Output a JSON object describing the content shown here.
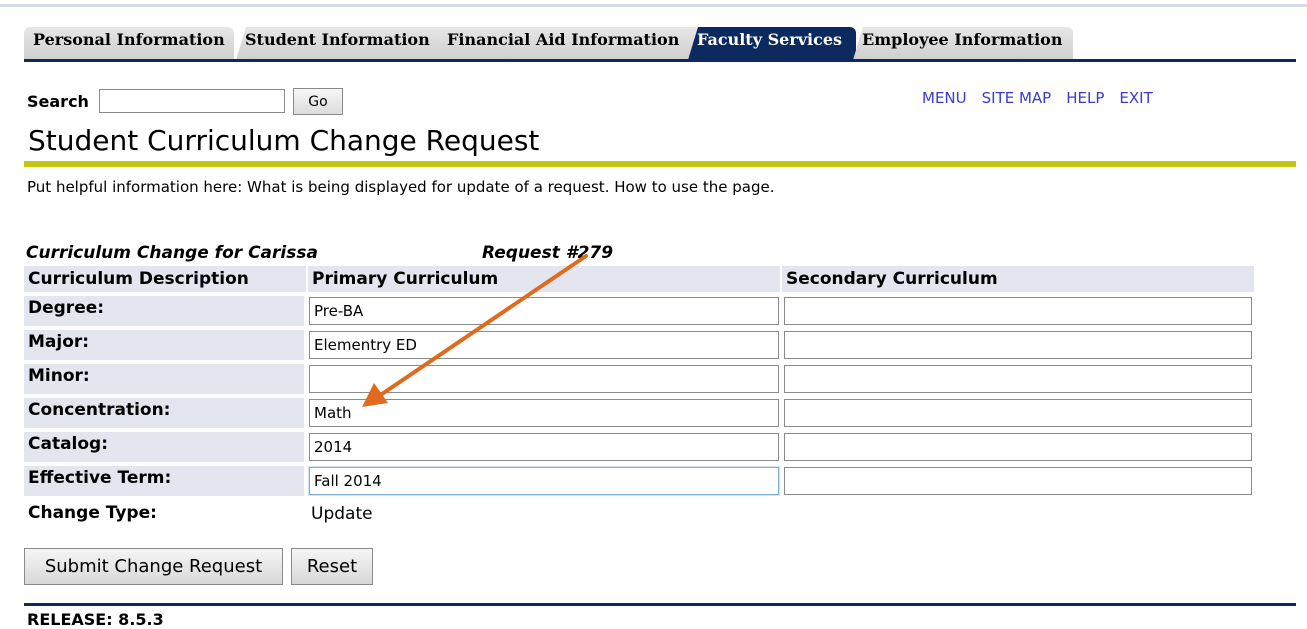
{
  "tabs": [
    {
      "label": "Personal Information"
    },
    {
      "label": "Student Information"
    },
    {
      "label": "Financial Aid Information"
    },
    {
      "label": "Faculty Services",
      "active": true
    },
    {
      "label": "Employee Information"
    }
  ],
  "search": {
    "label": "Search",
    "value": "",
    "go_label": "Go"
  },
  "top_links": {
    "menu": "MENU",
    "site_map": "SITE MAP",
    "help": "HELP",
    "exit": "EXIT"
  },
  "page_title": "Student Curriculum Change Request",
  "info_text": "Put helpful information here: What is being displayed for update of a request. How to use the page.",
  "request": {
    "heading": "Curriculum Change for Carissa",
    "number": "Request #279"
  },
  "grid": {
    "headers": {
      "description": "Curriculum Description",
      "primary": "Primary Curriculum",
      "secondary": "Secondary Curriculum"
    },
    "rows": [
      {
        "label": "Degree:",
        "primary": "Pre-BA",
        "secondary": ""
      },
      {
        "label": "Major:",
        "primary": "Elementry ED",
        "secondary": ""
      },
      {
        "label": "Minor:",
        "primary": "",
        "secondary": ""
      },
      {
        "label": "Concentration:",
        "primary": "Math",
        "secondary": ""
      },
      {
        "label": "Catalog:",
        "primary": "2014",
        "secondary": ""
      },
      {
        "label": "Effective Term:",
        "primary": "Fall 2014",
        "secondary": ""
      }
    ],
    "change_type": {
      "label": "Change Type:",
      "value": "Update"
    }
  },
  "buttons": {
    "submit": "Submit Change Request",
    "reset": "Reset"
  },
  "release": "RELEASE: 8.5.3",
  "colors": {
    "navy": "#0c2a5e",
    "olive": "#c6c614",
    "label_bg": "#e3e6ef",
    "link": "#3b3bd0",
    "arrow": "#e06b1f"
  }
}
